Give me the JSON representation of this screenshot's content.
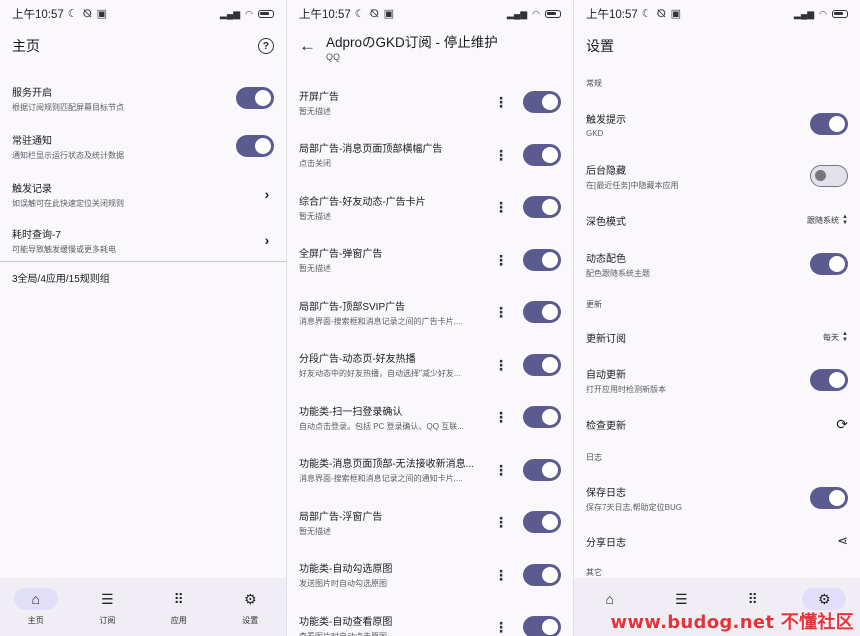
{
  "status": {
    "time": "上午10:57",
    "icons": "☾ ⦰ ▣",
    "net": "4G"
  },
  "p1": {
    "title": "主页",
    "rows": [
      {
        "title": "服务开启",
        "desc": "根据订阅规则匹配屏幕目标节点",
        "control": "toggle-on"
      },
      {
        "title": "常驻通知",
        "desc": "通知栏显示运行状态及统计数据",
        "control": "toggle-on"
      },
      {
        "title": "触发记录",
        "desc": "如误触可在此快速定位关闭规则",
        "control": "chevron"
      },
      {
        "title": "耗时查询-7",
        "desc": "可能导致触发缓慢或更多耗电",
        "control": "chevron"
      }
    ],
    "summary": "3全局/4应用/15规则组",
    "nav": [
      {
        "label": "主页",
        "icon": "home-icon",
        "active": true
      },
      {
        "label": "订阅",
        "icon": "list-icon",
        "active": false
      },
      {
        "label": "应用",
        "icon": "apps-icon",
        "active": false
      },
      {
        "label": "设置",
        "icon": "gear-icon",
        "active": false
      }
    ]
  },
  "p2": {
    "title": "AdproのGKD订阅 - 停止维护",
    "subtitle": "QQ",
    "rules": [
      {
        "title": "开屏广告",
        "desc": "暂无描述"
      },
      {
        "title": "局部广告-消息页面顶部横幅广告",
        "desc": "点击关闭"
      },
      {
        "title": "综合广告-好友动态-广告卡片",
        "desc": "暂无描述"
      },
      {
        "title": "全屏广告-弹窗广告",
        "desc": "暂无描述"
      },
      {
        "title": "局部广告-顶部SVIP广告",
        "desc": "消息界面-搜索框和消息记录之间的广告卡片,..."
      },
      {
        "title": "分段广告-动态页-好友热播",
        "desc": "好友动态中的好友热播，自动选择\"减少好友..."
      },
      {
        "title": "功能类-扫一扫登录确认",
        "desc": "自动点击登录。包括 PC 登录确认、QQ 互联..."
      },
      {
        "title": "功能类-消息页面顶部-无法接收新消息...",
        "desc": "消息界面-搜索框和消息记录之间的通知卡片,..."
      },
      {
        "title": "局部广告-浮窗广告",
        "desc": "暂无描述"
      },
      {
        "title": "功能类-自动勾选原图",
        "desc": "发送图片时自动勾选原图"
      },
      {
        "title": "功能类-自动查看原图",
        "desc": "查看图片时自动点击原图"
      }
    ]
  },
  "p3": {
    "title": "设置",
    "sections": {
      "general": "常规",
      "update": "更新",
      "log": "日志",
      "other": "其它"
    },
    "rows": {
      "trigger_tip": {
        "title": "触发提示",
        "desc": "GKD"
      },
      "hide_bg": {
        "title": "后台隐藏",
        "desc": "在[最近任务]中隐藏本应用"
      },
      "dark_mode": {
        "title": "深色模式",
        "value": "跟随系统"
      },
      "dynamic_color": {
        "title": "动态配色",
        "desc": "配色跟随系统主题"
      },
      "update_sub": {
        "title": "更新订阅",
        "value": "每天"
      },
      "auto_update": {
        "title": "自动更新",
        "desc": "打开应用时检测新版本"
      },
      "check_update": {
        "title": "检查更新"
      },
      "save_log": {
        "title": "保存日志",
        "desc": "保存7天日志,帮助定位BUG"
      },
      "share_log": {
        "title": "分享日志"
      }
    }
  },
  "watermark": "www.budog.net 不懂社区",
  "colors": {
    "accent": "#5c5b8f",
    "nav_bg": "#f0edf4",
    "active_pill": "#e1dff9",
    "watermark": "#e8323a"
  }
}
